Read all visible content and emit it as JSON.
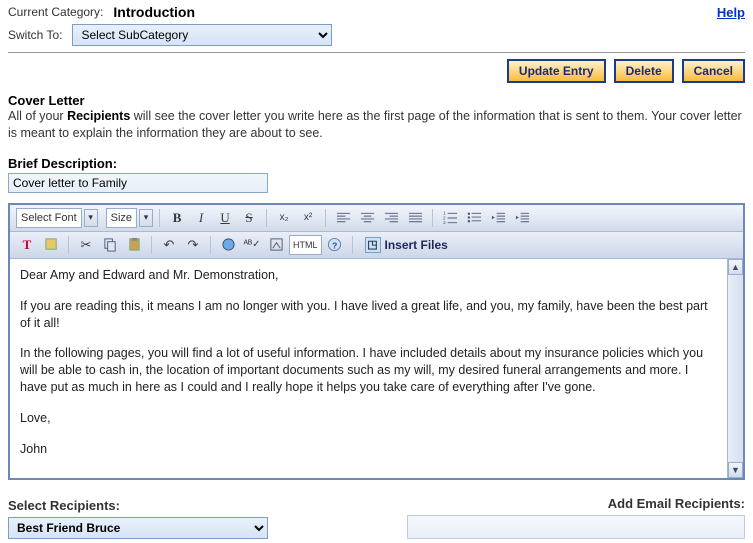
{
  "header": {
    "current_category_label": "Current Category:",
    "current_category_value": "Introduction",
    "help": "Help",
    "switch_to_label": "Switch To:",
    "switch_to_value": "Select SubCategory"
  },
  "buttons": {
    "update": "Update Entry",
    "delete": "Delete",
    "cancel": "Cancel"
  },
  "cover_letter": {
    "heading": "Cover Letter",
    "desc_pre": "All of your ",
    "desc_bold": "Recipients",
    "desc_post": " will see the cover letter you write here as the first page of the information that is sent to them. Your cover letter is meant to explain the information they are about to see."
  },
  "brief": {
    "label": "Brief Description:",
    "value": "Cover letter to Family"
  },
  "toolbar": {
    "font_label": "Select Font",
    "size_label": "Size",
    "html_label": "HTML",
    "insert_files": "Insert Files"
  },
  "editor": {
    "p1": "Dear Amy and Edward and Mr. Demonstration,",
    "p2": "If you are reading this, it means I am no longer with you. I have lived a great life, and you, my family, have been the best part of it all!",
    "p3": "In the following pages, you will find a lot of useful information. I have included details about my insurance policies which you will be able to cash in, the location of important documents such as my will, my desired funeral arrangements and more. I have put as much in here as I could and I really hope it helps you take care of everything after I've gone.",
    "p4": "Love,",
    "p5": "John"
  },
  "recipients": {
    "select_label": "Select Recipients:",
    "select_value": "Best Friend Bruce",
    "add_email_label": "Add Email Recipients:"
  }
}
